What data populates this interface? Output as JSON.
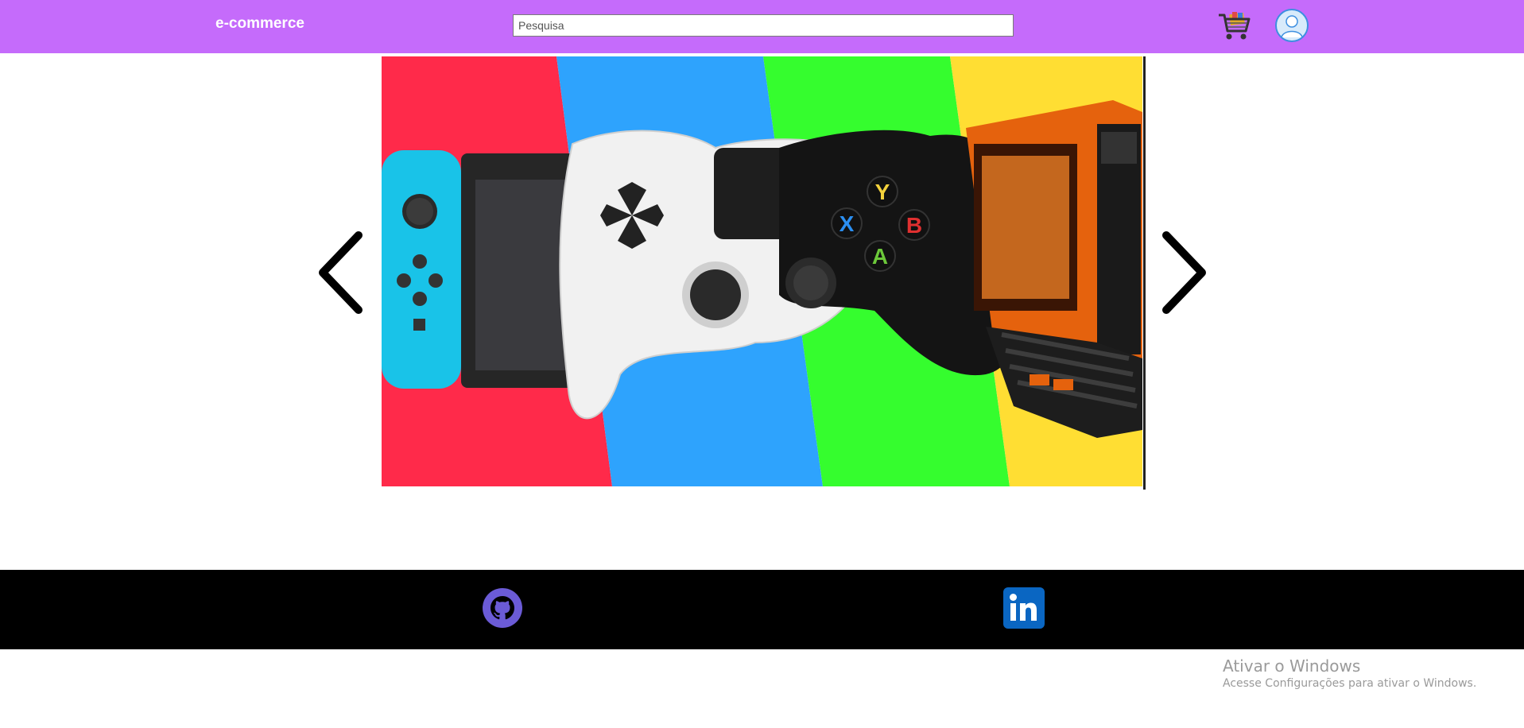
{
  "header": {
    "brand": "e-commerce",
    "search_placeholder": "Pesquisa",
    "bg_color": "#c56bfb"
  },
  "icons": {
    "cart": "shopping-cart-icon",
    "profile": "user-avatar-icon",
    "prev": "chevron-left-icon",
    "next": "chevron-right-icon",
    "github": "github-icon",
    "linkedin": "linkedin-icon"
  },
  "carousel": {
    "slide_image": "gaming-consoles-controllers-pc-banner"
  },
  "colors": {
    "red_stripe": "#ff2a4a",
    "blue_stripe": "#2ea3fd",
    "green_stripe": "#35fd2e",
    "yellow_stripe": "#ffde33",
    "footer_bg": "#000000"
  },
  "watermark": {
    "title": "Ativar o Windows",
    "subtitle": "Acesse Configurações para ativar o Windows."
  }
}
